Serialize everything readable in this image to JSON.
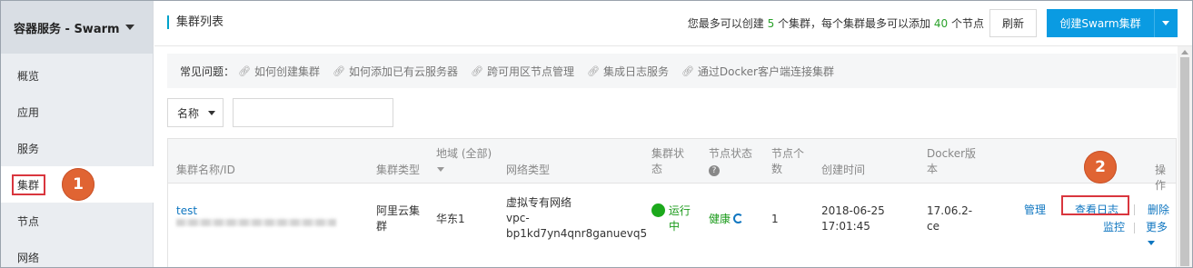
{
  "sidebar": {
    "title": "容器服务 - Swarm",
    "items": [
      {
        "label": "概览"
      },
      {
        "label": "应用"
      },
      {
        "label": "服务"
      },
      {
        "label": "集群"
      },
      {
        "label": "节点"
      },
      {
        "label": "网络"
      }
    ],
    "active_index": 3
  },
  "callouts": {
    "one": "1",
    "two": "2"
  },
  "header": {
    "title": "集群列表",
    "quota_prefix": "您最多可以创建",
    "quota_clusters": "5",
    "quota_mid": "个集群，每个集群最多可以添加",
    "quota_nodes": "40",
    "quota_suffix": "个节点",
    "refresh_label": "刷新",
    "create_label": "创建Swarm集群"
  },
  "faq": {
    "label": "常见问题：",
    "links": [
      "如何创建集群",
      "如何添加已有云服务器",
      "跨可用区节点管理",
      "集成日志服务",
      "通过Docker客户端连接集群"
    ]
  },
  "filter": {
    "select_value": "名称",
    "input_value": ""
  },
  "table": {
    "headers": {
      "name": "集群名称/ID",
      "type": "集群类型",
      "region_line1": "地域 (全部)",
      "network": "网络类型",
      "status_line1": "集群状",
      "status_line2": "态",
      "node_status": "节点状态",
      "node_count_line1": "节点个",
      "node_count_line2": "数",
      "created": "创建时间",
      "docker_line1": "Docker版",
      "docker_line2": "本",
      "actions": "操作"
    },
    "rows": [
      {
        "name": "test",
        "type_line1": "阿里云集",
        "type_line2": "群",
        "region": "华东1",
        "network_line1": "虚拟专有网络",
        "network_line2": "vpc-",
        "network_line3": "bp1kd7yn4qnr8ganuevq5",
        "status_line1": "运行",
        "status_line2": "中",
        "node_status": "健康",
        "node_count": "1",
        "created_line1": "2018-06-25",
        "created_line2": "17:01:45",
        "docker_line1": "17.06.2-",
        "docker_line2": "ce",
        "actions": {
          "manage": "管理",
          "view_logs": "查看日志",
          "delete": "删除",
          "monitor": "监控",
          "more": "更多"
        }
      }
    ]
  },
  "colors": {
    "accent": "#0a9be2",
    "link": "#0f76c0",
    "ok": "#1ca91c",
    "callout": "#e06433",
    "highlight": "#d9363e"
  }
}
